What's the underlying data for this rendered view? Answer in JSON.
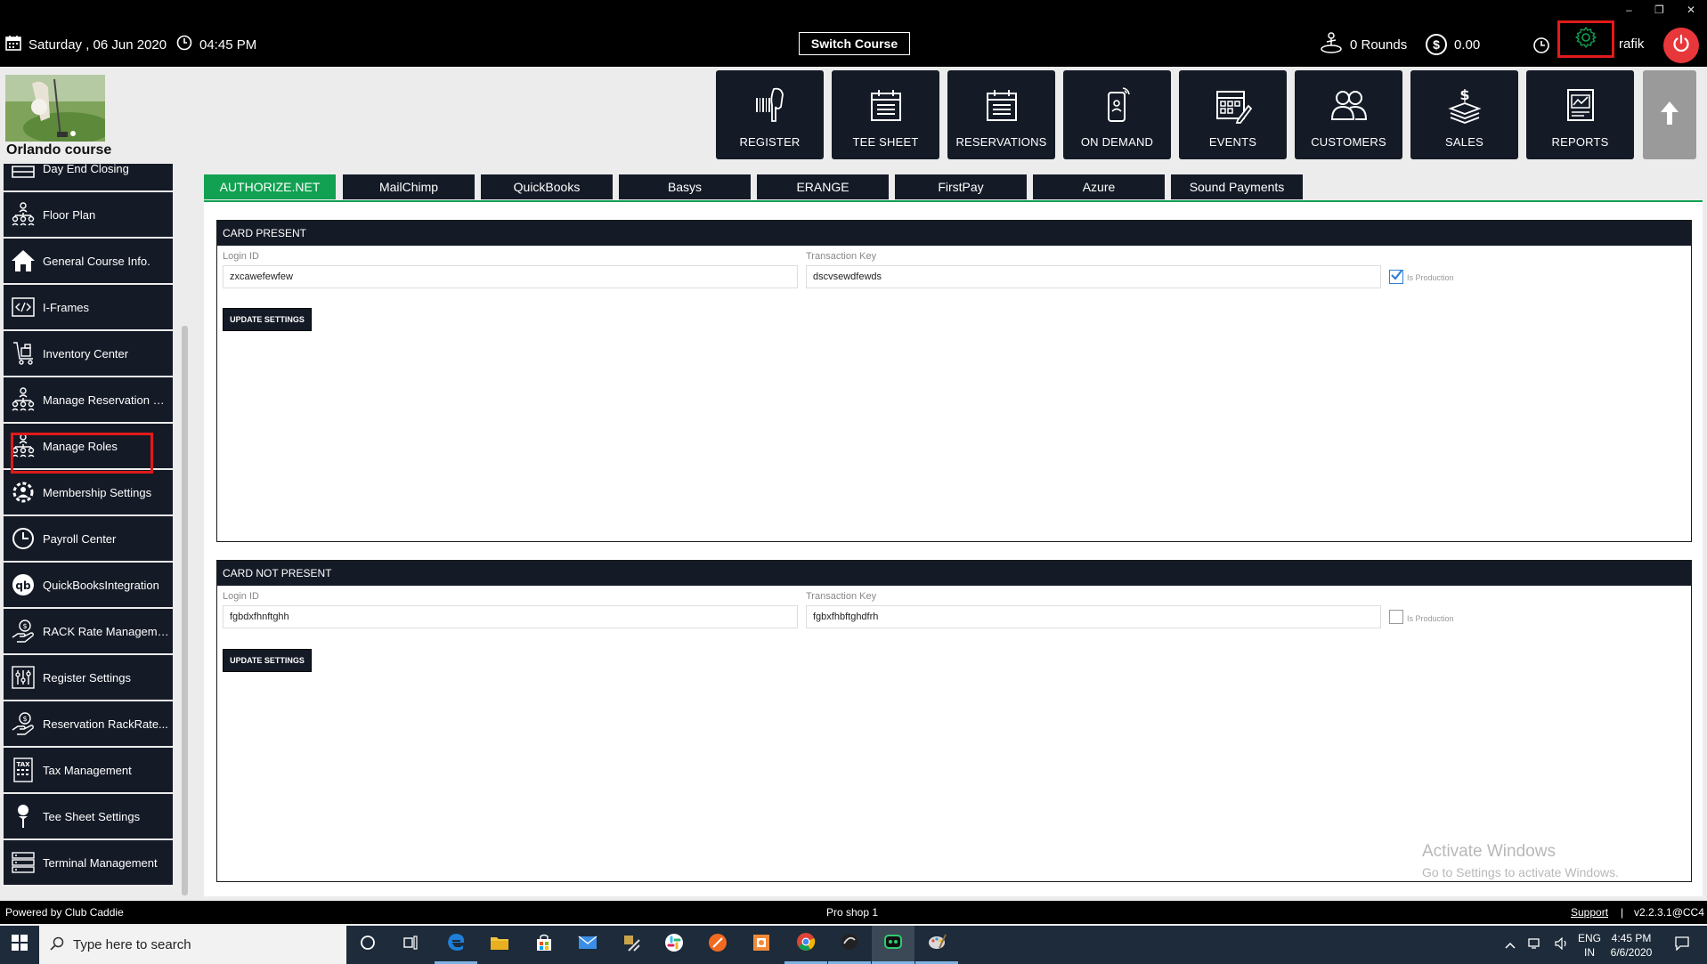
{
  "window_controls": {
    "minimize": "–",
    "restore": "❐",
    "close": "✕"
  },
  "topbar": {
    "date": "Saturday ,  06 Jun 2020",
    "time": "04:45 PM",
    "switch_course": "Switch Course",
    "rounds": "0 Rounds",
    "money": "0.00",
    "money_symbol": "$",
    "user": "rafik",
    "icons": [
      "calendar-icon",
      "clock-icon",
      "golfer-icon",
      "dollar-icon",
      "history-icon",
      "gear-icon",
      "power-icon"
    ],
    "accent_settings": "#12a152",
    "power_color": "#e8373b"
  },
  "header": {
    "course_name": "Orlando course",
    "nav": [
      {
        "label": "REGISTER",
        "icon": "barcode-scanner-icon"
      },
      {
        "label": "TEE SHEET",
        "icon": "calendar-list-icon"
      },
      {
        "label": "RESERVATIONS",
        "icon": "calendar-list-icon"
      },
      {
        "label": "ON DEMAND",
        "icon": "mobile-icon"
      },
      {
        "label": "EVENTS",
        "icon": "calendar-edit-icon"
      },
      {
        "label": "CUSTOMERS",
        "icon": "users-icon"
      },
      {
        "label": "SALES",
        "icon": "cash-icon"
      },
      {
        "label": "REPORTS",
        "icon": "report-chart-icon"
      }
    ]
  },
  "sidebar": {
    "items": [
      {
        "label": "Day End Closing",
        "icon": "cash-register-icon"
      },
      {
        "label": "Floor Plan",
        "icon": "hierarchy-icon"
      },
      {
        "label": "General Course Info.",
        "icon": "home-icon"
      },
      {
        "label": "I-Frames",
        "icon": "code-icon"
      },
      {
        "label": "Inventory Center",
        "icon": "inventory-icon"
      },
      {
        "label": "Manage Reservation R...",
        "icon": "hierarchy-icon"
      },
      {
        "label": "Manage Roles",
        "icon": "hierarchy-icon"
      },
      {
        "label": "Membership Settings",
        "icon": "member-gear-icon"
      },
      {
        "label": "Payroll Center",
        "icon": "clock-icon"
      },
      {
        "label": "QuickBooksIntegration",
        "icon": "quickbooks-icon"
      },
      {
        "label": "RACK Rate Manageme...",
        "icon": "money-hand-icon"
      },
      {
        "label": "Register Settings",
        "icon": "sliders-icon"
      },
      {
        "label": "Reservation RackRate...",
        "icon": "money-hand-icon"
      },
      {
        "label": "Tax Management",
        "icon": "tax-icon"
      },
      {
        "label": "Tee Sheet Settings",
        "icon": "golf-tee-icon"
      },
      {
        "label": "Terminal Management",
        "icon": "server-icon"
      }
    ]
  },
  "tabs": [
    {
      "label": "AUTHORIZE.NET",
      "active": true
    },
    {
      "label": "MailChimp",
      "active": false
    },
    {
      "label": "QuickBooks",
      "active": false
    },
    {
      "label": "Basys",
      "active": false
    },
    {
      "label": "ERANGE",
      "active": false
    },
    {
      "label": "FirstPay",
      "active": false
    },
    {
      "label": "Azure",
      "active": false
    },
    {
      "label": "Sound Payments",
      "active": false
    }
  ],
  "panels": {
    "card_present": {
      "title": "CARD PRESENT",
      "login_label": "Login ID",
      "login_value": "zxcawefewfew",
      "key_label": "Transaction Key",
      "key_value": "dscvsewdfewds",
      "production_label": "Is Production",
      "production_checked": true,
      "button": "UPDATE SETTINGS"
    },
    "card_not_present": {
      "title": "CARD NOT PRESENT",
      "login_label": "Login ID",
      "login_value": "fgbdxfhnftghh",
      "key_label": "Transaction Key",
      "key_value": "fgbxfhbftghdfrh",
      "production_label": "Is Production",
      "production_checked": false,
      "button": "UPDATE SETTINGS"
    }
  },
  "watermark": {
    "title": "Activate Windows",
    "subtitle": "Go to Settings to activate Windows."
  },
  "statusbar": {
    "left": "Powered by Club Caddie",
    "center": "Pro shop 1",
    "support": "Support",
    "separator": "|",
    "version": "v2.2.3.1@CC4"
  },
  "taskbar": {
    "search_placeholder": "Type here to search",
    "apps": [
      "cortana-icon",
      "task-view-icon",
      "edge-icon",
      "file-explorer-icon",
      "store-icon",
      "mail-icon",
      "tools-icon",
      "slack-icon",
      "app-orange-icon",
      "app-box-icon",
      "chrome-icon",
      "app-dark-icon",
      "app-green-icon",
      "app-paint-icon"
    ],
    "lang": "ENG",
    "region": "IN",
    "time": "4:45 PM",
    "date": "6/6/2020"
  }
}
